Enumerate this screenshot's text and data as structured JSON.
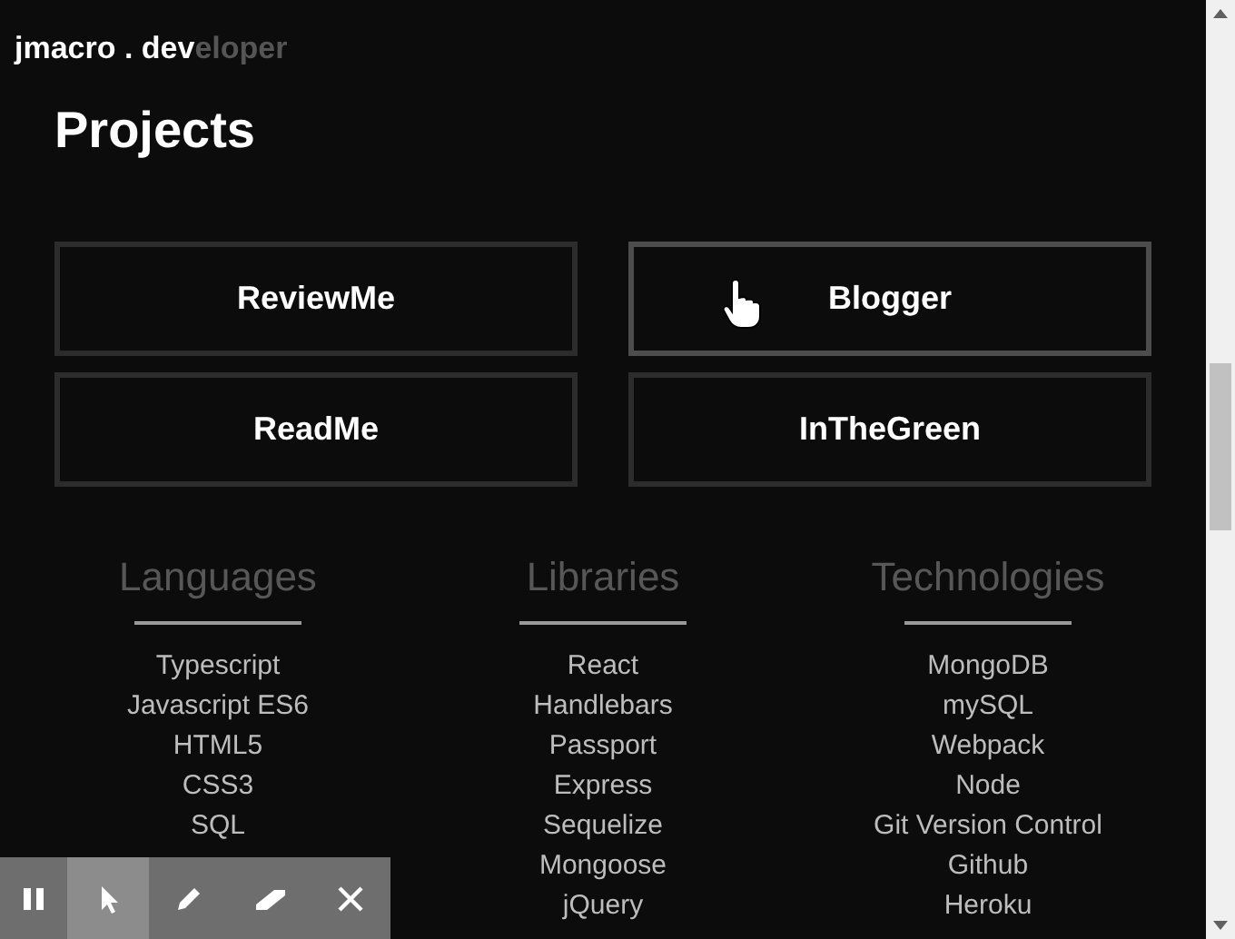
{
  "logo": {
    "bright": "jmacro . dev",
    "dim": "eloper"
  },
  "projects": {
    "title": "Projects",
    "items": [
      {
        "label": "ReviewMe",
        "hovered": false
      },
      {
        "label": "Blogger",
        "hovered": true
      },
      {
        "label": "ReadMe",
        "hovered": false
      },
      {
        "label": "InTheGreen",
        "hovered": false
      }
    ]
  },
  "skills": [
    {
      "title": "Languages",
      "items": [
        "Typescript",
        "Javascript ES6",
        "HTML5",
        "CSS3",
        "SQL"
      ]
    },
    {
      "title": "Libraries",
      "items": [
        "React",
        "Handlebars",
        "Passport",
        "Express",
        "Sequelize",
        "Mongoose",
        "jQuery"
      ]
    },
    {
      "title": "Technologies",
      "items": [
        "MongoDB",
        "mySQL",
        "Webpack",
        "Node",
        "Git Version Control",
        "Github",
        "Heroku"
      ]
    }
  ],
  "toolbar": [
    {
      "kind": "pause",
      "selected": false
    },
    {
      "kind": "pointer",
      "selected": true
    },
    {
      "kind": "pen",
      "selected": false
    },
    {
      "kind": "eraser",
      "selected": false
    },
    {
      "kind": "close",
      "selected": false
    }
  ]
}
